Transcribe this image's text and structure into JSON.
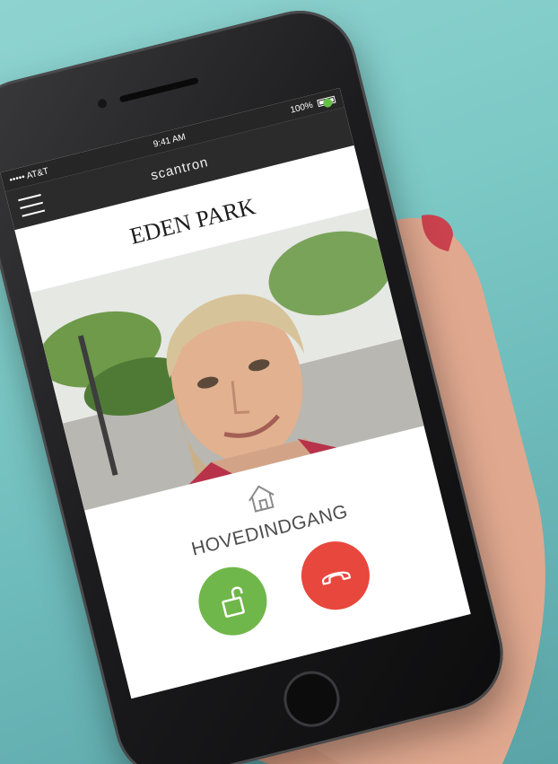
{
  "status_bar": {
    "carrier": "••••• AT&T",
    "time": "9:41 AM",
    "battery": "100%"
  },
  "nav": {
    "brand": "scantron",
    "menu_icon": "hamburger-menu-icon",
    "connection_status_color": "#64c146"
  },
  "property": {
    "name": "EDEN PARK"
  },
  "entrance": {
    "icon": "house-icon",
    "label": "HOVEDINDGANG"
  },
  "actions": {
    "unlock": {
      "icon": "unlock-padlock-icon",
      "color": "#6fb74a"
    },
    "hangup": {
      "icon": "phone-hangup-icon",
      "color": "#e8473d"
    }
  }
}
